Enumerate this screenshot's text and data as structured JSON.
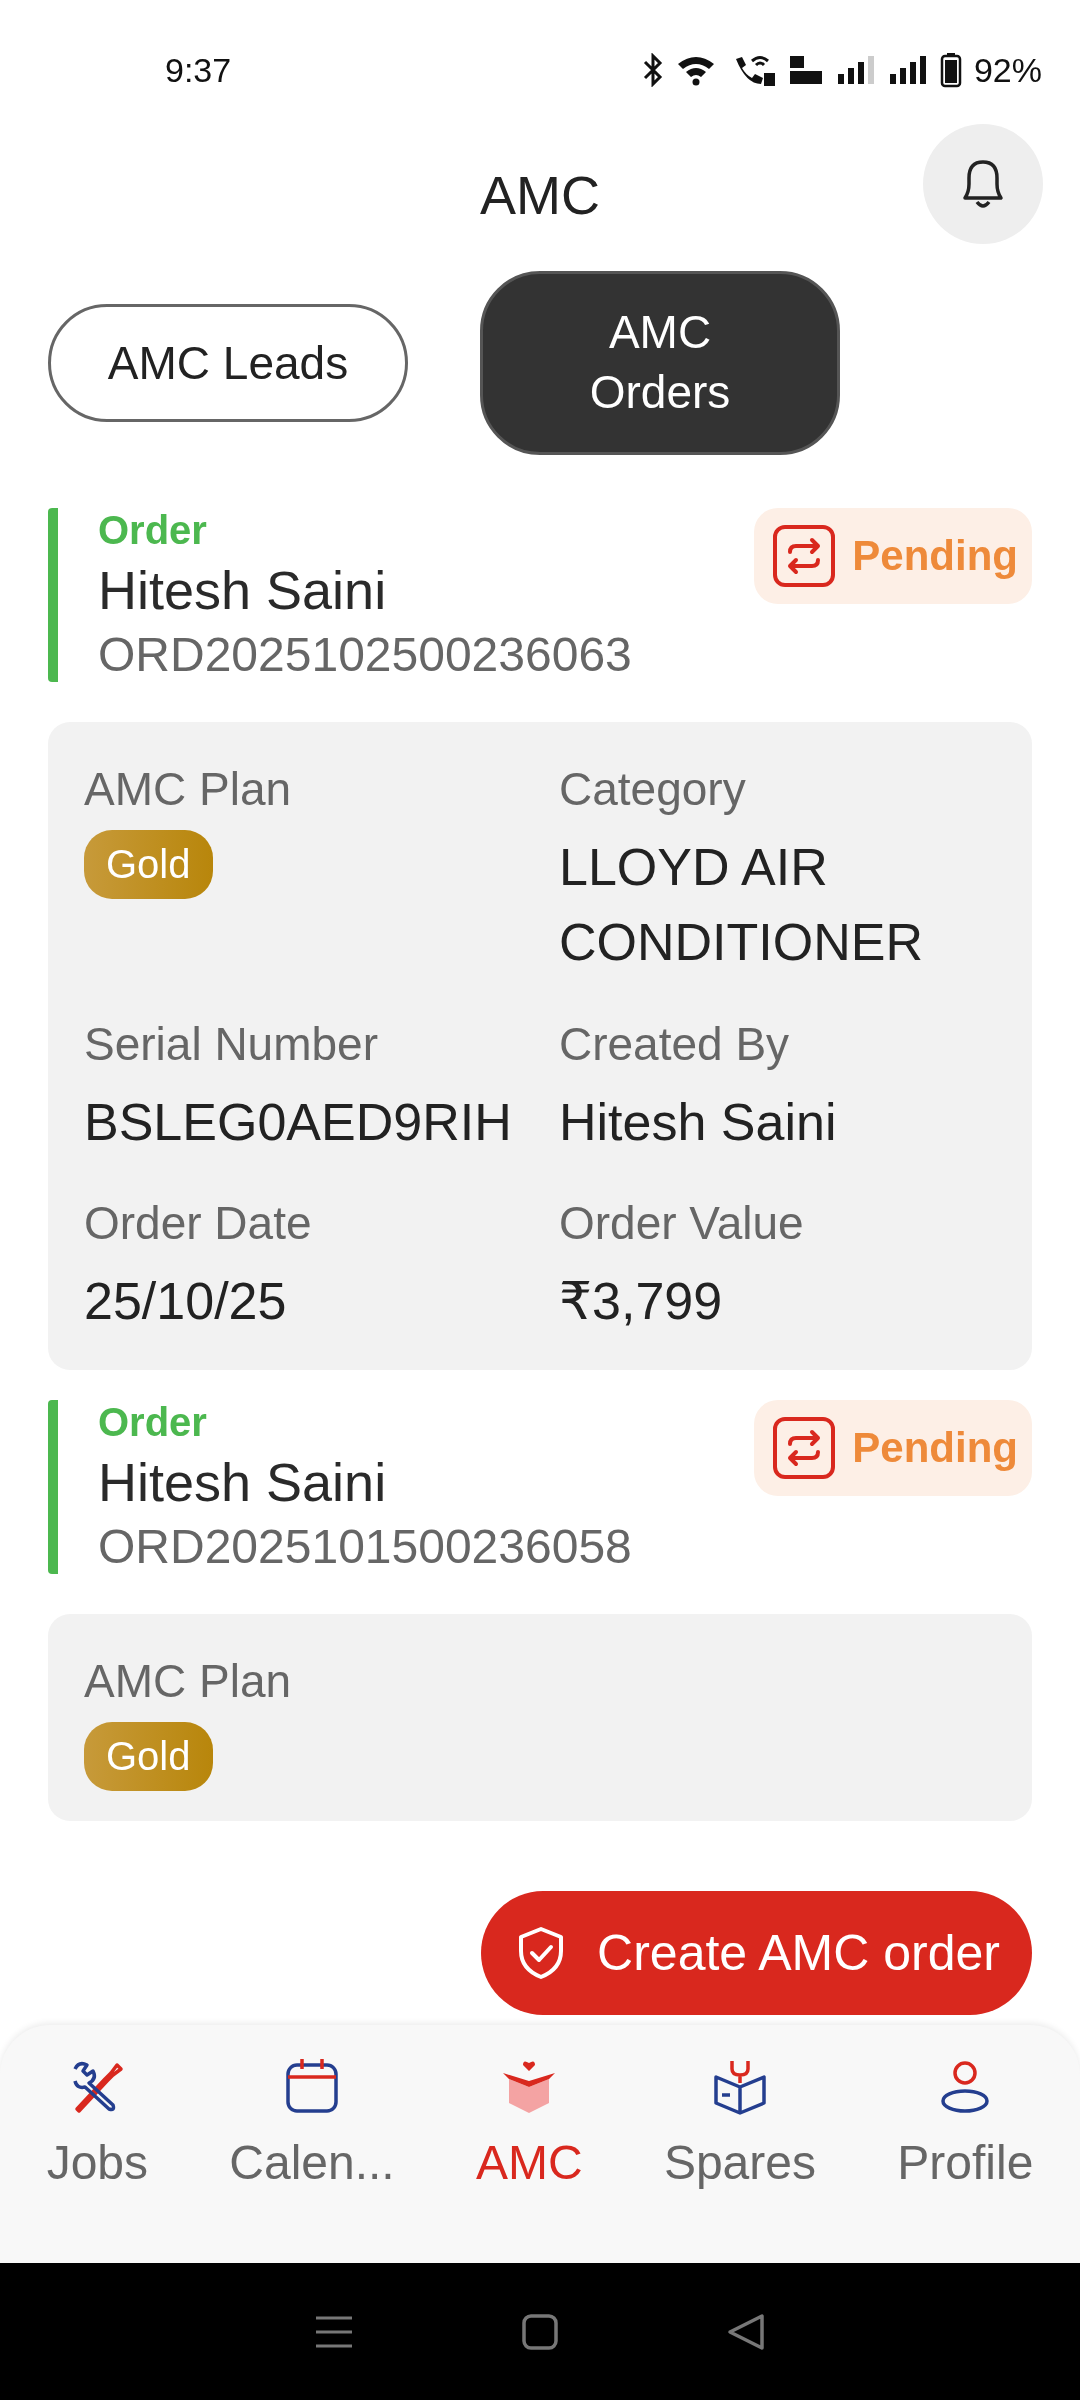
{
  "status_bar": {
    "time": "9:37",
    "battery": "92%"
  },
  "header": {
    "title": "AMC"
  },
  "tabs": [
    {
      "label": "AMC Leads",
      "selected": false
    },
    {
      "label": "AMC Orders",
      "selected": true
    }
  ],
  "orders": [
    {
      "type_label": "Order",
      "name": "Hitesh Saini",
      "order_id": "ORD2025102500236063",
      "status": "Pending",
      "details": [
        {
          "label": "AMC Plan",
          "value": "Gold",
          "kind": "badge"
        },
        {
          "label": "Category",
          "value": "LLOYD AIR CONDITIONER",
          "kind": "text"
        },
        {
          "label": "Serial Number",
          "value": "BSLEG0AED9RIH",
          "kind": "text"
        },
        {
          "label": "Created By",
          "value": "Hitesh Saini",
          "kind": "text"
        },
        {
          "label": "Order Date",
          "value": "25/10/25",
          "kind": "text"
        },
        {
          "label": "Order Value",
          "value": "₹3,799",
          "kind": "text"
        }
      ]
    },
    {
      "type_label": "Order",
      "name": "Hitesh Saini",
      "order_id": "ORD2025101500236058",
      "status": "Pending",
      "details": [
        {
          "label": "AMC Plan",
          "value": "Gold",
          "kind": "badge"
        }
      ]
    }
  ],
  "fab": {
    "label": "Create AMC order"
  },
  "bottom_nav": [
    {
      "label": "Jobs",
      "selected": false
    },
    {
      "label": "Calen...",
      "selected": false
    },
    {
      "label": "AMC",
      "selected": true
    },
    {
      "label": "Spares",
      "selected": false
    },
    {
      "label": "Profile",
      "selected": false
    }
  ]
}
